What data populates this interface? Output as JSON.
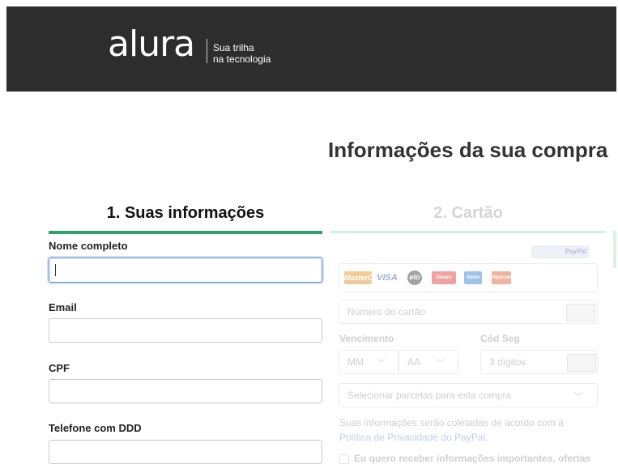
{
  "header": {
    "logo_text": "alura",
    "tagline_line1": "Sua trilha",
    "tagline_line2": "na tecnologia",
    "background": "#2d2d2d"
  },
  "page": {
    "title": "Informações da sua compra"
  },
  "steps": [
    {
      "label": "1. Suas informações",
      "active": true,
      "accent": "#2ba36a"
    },
    {
      "label": "2. Cartão",
      "active": false
    }
  ],
  "form": {
    "full_name_label": "Nome completo",
    "full_name_value": "",
    "email_label": "Email",
    "email_value": "",
    "cpf_label": "CPF",
    "cpf_value": "",
    "phone_label": "Telefone com DDD",
    "phone_value": ""
  },
  "card": {
    "paypal_badge": "PayPal",
    "brands": [
      "MasterCard",
      "VISA",
      "elo",
      "Diners",
      "Amex",
      "Hipercard"
    ],
    "card_number_placeholder": "Número do cartão",
    "expiry_label": "Vencimento",
    "month_placeholder": "MM",
    "year_placeholder": "AA",
    "cvv_label": "Cód Seg",
    "cvv_placeholder": "3 dígitos",
    "installments_placeholder": "Selecionar parcelas para esta compra",
    "notice_text": "Suas informações serão coletadas de acordo com a",
    "notice_link": "Política de Privacidade do PayPal.",
    "optin_text": "Eu quero receber informações importantes, ofertas"
  }
}
